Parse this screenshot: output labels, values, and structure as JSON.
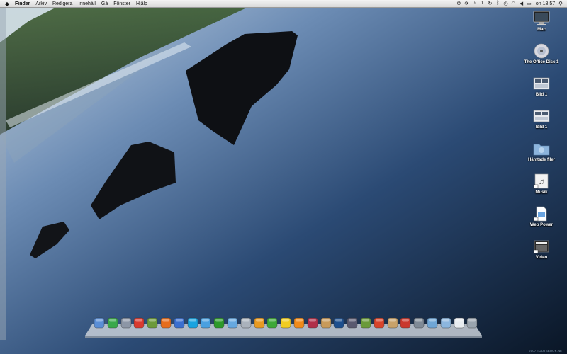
{
  "menubar": {
    "apple_icon": "apple-icon",
    "menus": [
      {
        "name": "menu-finder",
        "label": "Finder",
        "app": true
      },
      {
        "name": "menu-arkiv",
        "label": "Arkiv"
      },
      {
        "name": "menu-redigera",
        "label": "Redigera"
      },
      {
        "name": "menu-innehall",
        "label": "Innehåll"
      },
      {
        "name": "menu-ga",
        "label": "Gå"
      },
      {
        "name": "menu-fonster",
        "label": "Fönster"
      },
      {
        "name": "menu-hjalp",
        "label": "Hjälp"
      }
    ],
    "extras": [
      {
        "name": "gear-icon",
        "glyph": "⚙"
      },
      {
        "name": "sync-icon",
        "glyph": "⟳"
      },
      {
        "name": "music-note-icon",
        "glyph": "♪"
      },
      {
        "name": "calendar-day-icon",
        "glyph": "1"
      },
      {
        "name": "refresh-icon",
        "glyph": "↻"
      },
      {
        "name": "bluetooth-icon",
        "glyph": "ᛒ"
      },
      {
        "name": "time-machine-icon",
        "glyph": "◷"
      },
      {
        "name": "wifi-icon",
        "glyph": "◠"
      },
      {
        "name": "volume-icon",
        "glyph": "◀"
      },
      {
        "name": "battery-icon",
        "glyph": "▭"
      }
    ],
    "clock": "on 18.57",
    "spotlight_glyph": "⚲"
  },
  "desktop_icons": [
    {
      "name": "desktop-icon-mac",
      "label": "Mac",
      "kind": "monitor"
    },
    {
      "name": "desktop-icon-office-disc",
      "label": "The Office Disc 1",
      "kind": "disc"
    },
    {
      "name": "desktop-icon-bild-1a",
      "label": "Bild 1",
      "kind": "screenshot"
    },
    {
      "name": "desktop-icon-bild-1b",
      "label": "Bild 1",
      "kind": "screenshot"
    },
    {
      "name": "desktop-icon-hamtade-filer",
      "label": "Hämtade filer",
      "kind": "folder-download"
    },
    {
      "name": "desktop-icon-musik",
      "label": "Musik",
      "kind": "alias-music"
    },
    {
      "name": "desktop-icon-web-power",
      "label": "Web Power",
      "kind": "alias-doc"
    },
    {
      "name": "desktop-icon-video",
      "label": "Video",
      "kind": "alias-video"
    }
  ],
  "dock": [
    {
      "name": "dock-finder-icon",
      "color": "#5a8ed6"
    },
    {
      "name": "dock-adium-icon",
      "color": "#3aa84a"
    },
    {
      "name": "dock-system-preferences-icon",
      "color": "#8c96a6"
    },
    {
      "name": "dock-ical-icon",
      "color": "#d93a2f"
    },
    {
      "name": "dock-iphoto-icon",
      "color": "#6c9a3a"
    },
    {
      "name": "dock-firefox-icon",
      "color": "#e56d1c"
    },
    {
      "name": "dock-itunes-icon",
      "color": "#3a6fd0"
    },
    {
      "name": "dock-skype-icon",
      "color": "#18a3e0"
    },
    {
      "name": "dock-safari-icon",
      "color": "#4aa0e0"
    },
    {
      "name": "dock-spotify-icon",
      "color": "#2d9a2a"
    },
    {
      "name": "dock-itunes2-icon",
      "color": "#66a8e0"
    },
    {
      "name": "dock-tool-icon",
      "color": "#aab2bc"
    },
    {
      "name": "dock-app-orange-icon",
      "color": "#e89a22"
    },
    {
      "name": "dock-app-green-icon",
      "color": "#3ea838"
    },
    {
      "name": "dock-duck-icon",
      "color": "#f0cc22"
    },
    {
      "name": "dock-vlc-icon",
      "color": "#f08a1a"
    },
    {
      "name": "dock-photobooth-icon",
      "color": "#b0304a"
    },
    {
      "name": "dock-preview-icon",
      "color": "#c89a5a"
    },
    {
      "name": "dock-photoshop-icon",
      "color": "#1d4f8e"
    },
    {
      "name": "dock-pen-icon",
      "color": "#5a5a70"
    },
    {
      "name": "dock-chart-icon",
      "color": "#6a9a3a"
    },
    {
      "name": "dock-star-icon",
      "color": "#d8442a"
    },
    {
      "name": "dock-script-icon",
      "color": "#c8a26a"
    },
    {
      "name": "dock-activity-icon",
      "color": "#c9382e"
    },
    {
      "name": "dock-screen-icon",
      "color": "#7f8a96"
    },
    {
      "name": "dock-applications-stack-icon",
      "color": "#6fa6d6"
    },
    {
      "name": "dock-documents-stack-icon",
      "color": "#8cb6de"
    },
    {
      "name": "dock-file-icon",
      "color": "#e8ecf0"
    },
    {
      "name": "dock-trash-icon",
      "color": "#9aa4ae"
    }
  ],
  "credit": "2007 TOOTSBOOK.NET"
}
